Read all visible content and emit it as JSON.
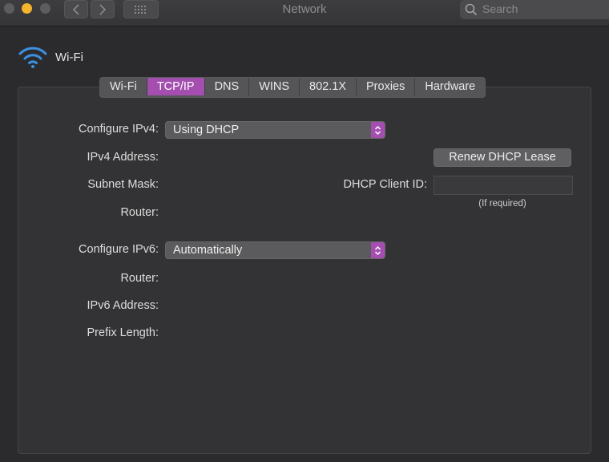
{
  "window": {
    "title": "Network"
  },
  "search": {
    "placeholder": "Search"
  },
  "interface": {
    "name": "Wi-Fi",
    "icon": "wifi-icon"
  },
  "tabs": [
    {
      "label": "Wi-Fi",
      "active": false
    },
    {
      "label": "TCP/IP",
      "active": true
    },
    {
      "label": "DNS",
      "active": false
    },
    {
      "label": "WINS",
      "active": false
    },
    {
      "label": "802.1X",
      "active": false
    },
    {
      "label": "Proxies",
      "active": false
    },
    {
      "label": "Hardware",
      "active": false
    }
  ],
  "ipv4": {
    "configure_label": "Configure IPv4:",
    "configure_value": "Using DHCP",
    "address_label": "IPv4 Address:",
    "subnet_label": "Subnet Mask:",
    "router_label": "Router:"
  },
  "dhcp": {
    "renew_label": "Renew DHCP Lease",
    "client_id_label": "DHCP Client ID:",
    "client_id_value": "",
    "hint": "(If required)"
  },
  "ipv6": {
    "configure_label": "Configure IPv6:",
    "configure_value": "Automatically",
    "router_label": "Router:",
    "address_label": "IPv6 Address:",
    "prefix_label": "Prefix Length:"
  },
  "colors": {
    "accent": "#a44fb0",
    "background": "#2b2b2d",
    "minimize": "#f5b52f"
  }
}
